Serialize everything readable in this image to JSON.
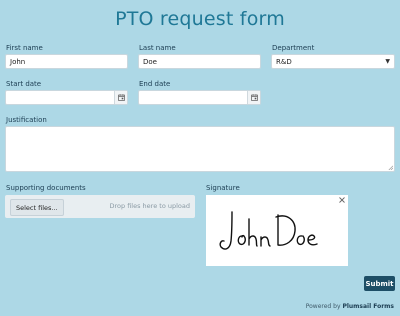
{
  "form": {
    "title": "PTO request form",
    "first_name": {
      "label": "First name",
      "value": "John"
    },
    "last_name": {
      "label": "Last name",
      "value": "Doe"
    },
    "department": {
      "label": "Department",
      "value": "R&D"
    },
    "start_date": {
      "label": "Start date",
      "value": ""
    },
    "end_date": {
      "label": "End date",
      "value": ""
    },
    "justification": {
      "label": "Justification",
      "value": ""
    },
    "supporting_documents": {
      "label": "Supporting documents",
      "button_label": "Select files...",
      "drop_hint": "Drop files here to upload"
    },
    "signature": {
      "label": "Signature",
      "signed_name": "John Doe"
    },
    "submit_label": "Submit"
  },
  "footer": {
    "prefix": "Powered by",
    "brand": "Plumsail Forms"
  },
  "icons": [
    "calendar-icon",
    "chevron-down-icon",
    "close-icon",
    "resize-grip-icon"
  ],
  "colors": {
    "background": "#add8e6",
    "title": "#1f7896",
    "submit": "#1d4e66"
  }
}
